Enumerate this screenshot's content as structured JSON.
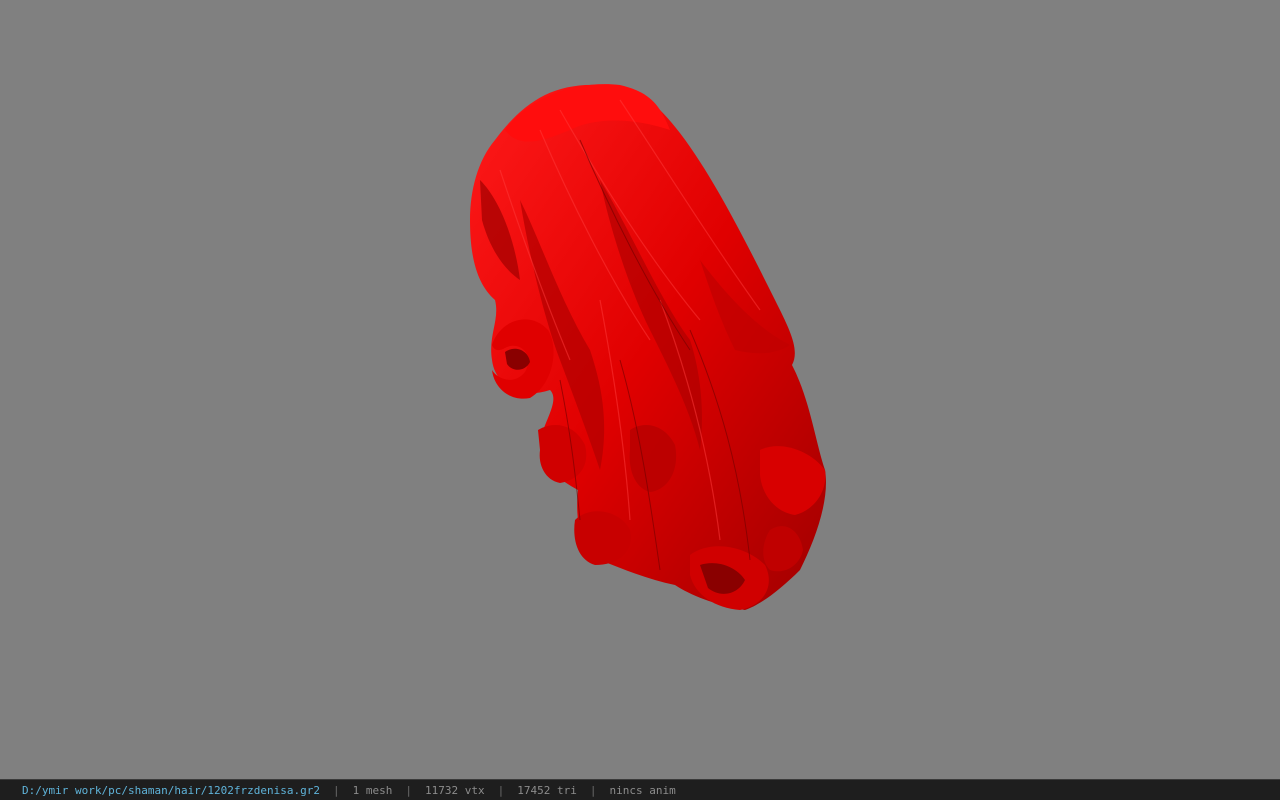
{
  "viewport": {
    "background": "#808080",
    "model_color": "#e00000",
    "model_shadow": "#8a0000",
    "model": "hair-mesh"
  },
  "statusbar": {
    "path": "D:/ymir work/pc/shaman/hair/1202frzdenisa.gr2",
    "separator": "|",
    "mesh": "1 mesh",
    "vtx": "11732 vtx",
    "tri": "17452 tri",
    "anim": "nincs anim"
  }
}
